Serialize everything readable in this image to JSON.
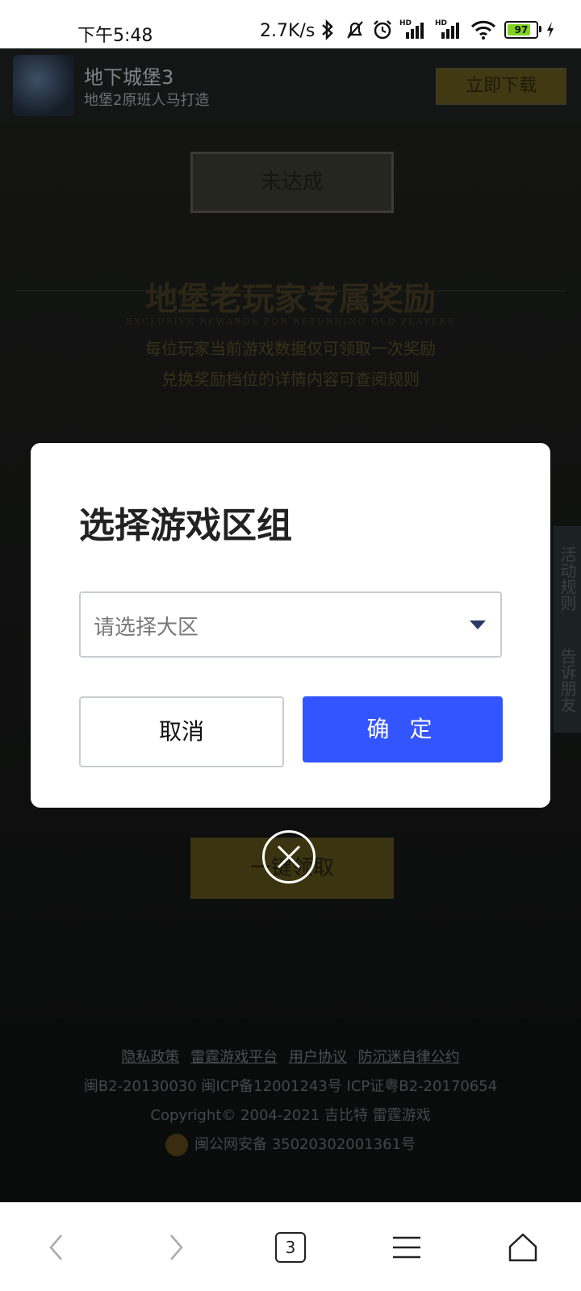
{
  "status_bar": {
    "time": "下午5:48",
    "net_speed": "2.7K/s",
    "battery": "97",
    "icons": [
      "bluetooth-icon",
      "mute-icon",
      "alarm-icon",
      "signal-hd-icon",
      "signal-hd-icon",
      "wifi-icon",
      "battery-icon",
      "charging-icon"
    ]
  },
  "header": {
    "title": "地下城堡3",
    "subtitle": "地堡2原班人马打造",
    "download_label": "立即下载"
  },
  "page": {
    "status_button": "未达成",
    "reward_title": "地堡老玩家专属奖励",
    "reward_title_en": "EXCLUSIVE REWARDS FOR RETURNING OLD PLAYERS",
    "reward_line1": "每位玩家当前游戏数据仅可领取一次奖励",
    "reward_line2": "兑换奖励档位的详情内容可查阅规则",
    "side_tab_rules": "活动规则",
    "side_tab_share": "告诉朋友",
    "claim_button": "一键领取"
  },
  "footer": {
    "links": [
      "隐私政策",
      "雷霆游戏平台",
      "用户协议",
      "防沉迷自律公约"
    ],
    "license": "闽B2-20130030  闽ICP备12001243号  ICP证粤B2-20170654",
    "copyright": "Copyright© 2004-2021  吉比特  雷霆游戏",
    "police": "闽公网安备 35020302001361号"
  },
  "dialog": {
    "title": "选择游戏区组",
    "select_placeholder": "请选择大区",
    "cancel_label": "取消",
    "confirm_label": "确 定"
  },
  "browser_nav": {
    "tab_count": "3"
  }
}
